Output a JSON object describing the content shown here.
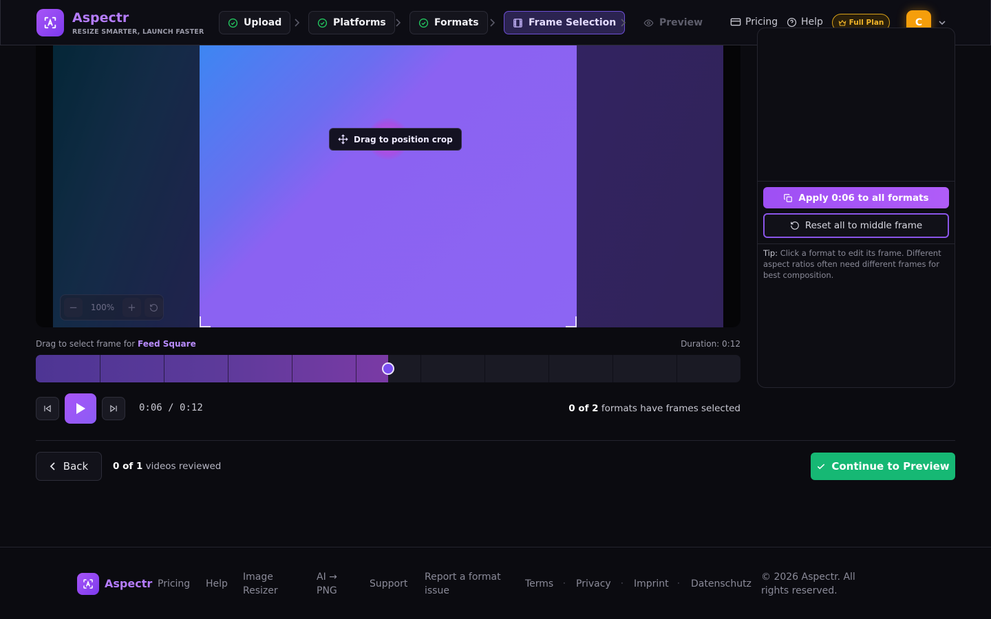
{
  "brand": {
    "name": "Aspectr",
    "tagline": "RESIZE SMARTER, LAUNCH FASTER"
  },
  "steps": [
    {
      "label": "Upload",
      "state": "done"
    },
    {
      "label": "Platforms",
      "state": "done"
    },
    {
      "label": "Formats",
      "state": "done"
    },
    {
      "label": "Frame Selection",
      "state": "active"
    },
    {
      "label": "Preview",
      "state": "disabled"
    }
  ],
  "nav": {
    "pricing": "Pricing",
    "help": "Help",
    "plan": "Full Plan",
    "avatar_initial": "C"
  },
  "video": {
    "tooltip": "Drag to position crop",
    "zoom": "100%"
  },
  "timeline": {
    "label_prefix": "Drag to select frame for",
    "format_name": "Feed Square",
    "duration": "Duration: 0:12",
    "progress_fraction": 0.5,
    "segments": 11
  },
  "controls": {
    "current": "0:06",
    "separator": "/",
    "total": "0:12"
  },
  "formats_status": {
    "count": "0 of 2",
    "suffix": "formats have frames selected"
  },
  "side_panel": {
    "apply_label": "Apply 0:06 to all formats",
    "reset_label": "Reset all to middle frame",
    "tip_label": "Tip:",
    "tip_text": "Click a format to edit its frame. Different aspect ratios often need different frames for best composition."
  },
  "bottom": {
    "back_label": "Back",
    "reviewed_count": "0 of 1",
    "reviewed_suffix": "videos reviewed",
    "continue_label": "Continue to Preview"
  },
  "footer": {
    "brand": "Aspectr",
    "links": [
      "Pricing",
      "Help",
      "Image Resizer",
      "AI → PNG",
      "Support",
      "Report a format issue",
      "Terms",
      "Privacy",
      "Imprint",
      "Datenschutz"
    ],
    "copyright": "© 2026 Aspectr. All rights reserved."
  },
  "colors": {
    "accent": "#a855f7",
    "success": "#16b874",
    "plan": "#f0b429",
    "check": "#22c55e"
  }
}
